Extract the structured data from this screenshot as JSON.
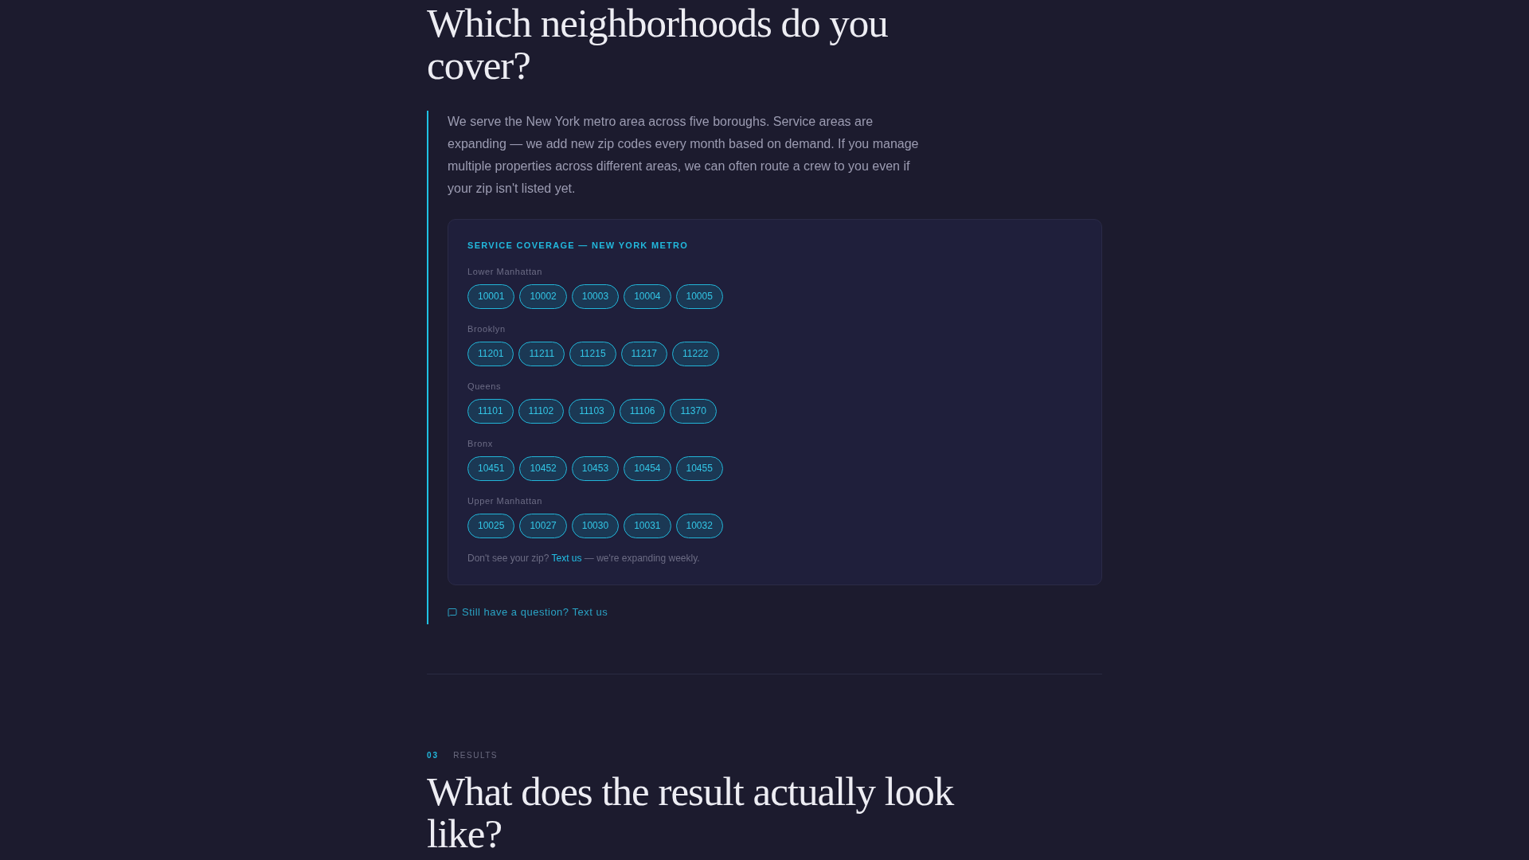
{
  "faq_heading": "Which neighborhoods do you cover?",
  "answer": {
    "text": "We serve the New York metro area across five boroughs. Service areas are expanding — we add new zip codes every month based on demand. If you manage multiple properties across different areas, we can often route a crew to you even if your zip isn't listed yet.",
    "coverage_card": {
      "title": "SERVICE COVERAGE — NEW YORK METRO",
      "areas": [
        {
          "name": "Lower Manhattan",
          "zips": [
            "10001",
            "10002",
            "10003",
            "10004",
            "10005"
          ]
        },
        {
          "name": "Brooklyn",
          "zips": [
            "11201",
            "11211",
            "11215",
            "11217",
            "11222"
          ]
        },
        {
          "name": "Queens",
          "zips": [
            "11101",
            "11102",
            "11103",
            "11106",
            "11370"
          ]
        },
        {
          "name": "Bronx",
          "zips": [
            "10451",
            "10452",
            "10453",
            "10454",
            "10455"
          ]
        },
        {
          "name": "Upper Manhattan",
          "zips": [
            "10025",
            "10027",
            "10030",
            "10031",
            "10032"
          ]
        }
      ],
      "note": {
        "before": "Don't see your zip?",
        "link": "Text us",
        "after": "— we're expanding weekly."
      }
    },
    "cta": "Still have a question? Text us"
  },
  "next_section": {
    "number": "03",
    "label": "RESULTS",
    "heading": "What does the result actually look like?"
  }
}
